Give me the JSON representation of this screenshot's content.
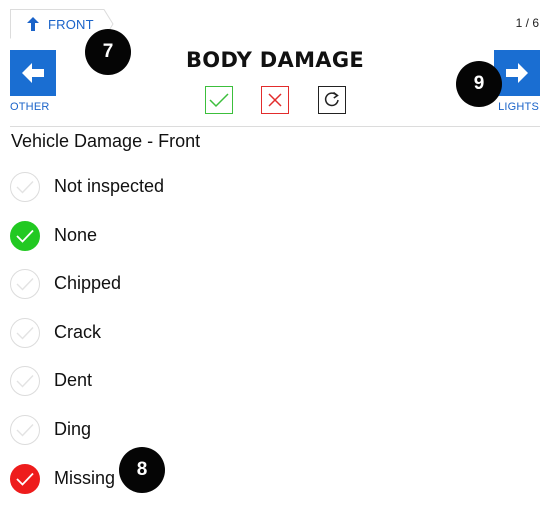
{
  "breadcrumb": {
    "label": "FRONT",
    "icon": "arrow-up-icon"
  },
  "page_counter": "1 / 6",
  "title": "BODY DAMAGE",
  "nav": {
    "prev": {
      "label": "OTHER",
      "icon": "arrow-left-icon"
    },
    "next": {
      "label": "LIGHTS",
      "icon": "arrow-right-icon"
    }
  },
  "actions": [
    {
      "name": "mark-ok",
      "icon": "check-icon",
      "color": "#3cbf3c"
    },
    {
      "name": "mark-fail",
      "icon": "x-icon",
      "color": "#e22c2c"
    },
    {
      "name": "reset",
      "icon": "refresh-icon",
      "color": "#222222"
    }
  ],
  "section_title": "Vehicle Damage - Front",
  "options": [
    {
      "label": "Not inspected",
      "state": "unchecked"
    },
    {
      "label": "None",
      "state": "ok"
    },
    {
      "label": "Chipped",
      "state": "unchecked"
    },
    {
      "label": "Crack",
      "state": "unchecked"
    },
    {
      "label": "Dent",
      "state": "unchecked"
    },
    {
      "label": "Ding",
      "state": "unchecked"
    },
    {
      "label": "Missing",
      "state": "fail"
    }
  ],
  "callouts": [
    "7",
    "8",
    "9"
  ],
  "colors": {
    "accent": "#1a6ed2",
    "ok": "#22c922",
    "fail": "#ee1c1c"
  }
}
